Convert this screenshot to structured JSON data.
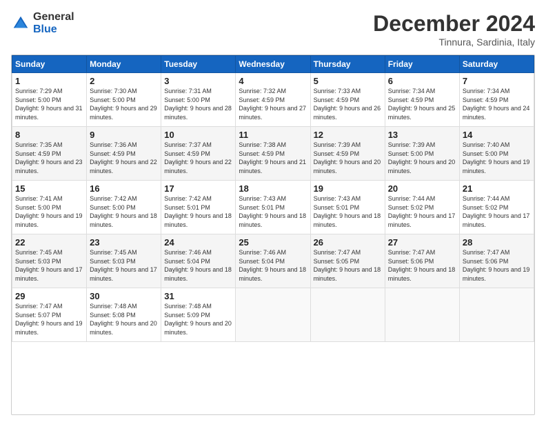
{
  "logo": {
    "general": "General",
    "blue": "Blue"
  },
  "title": "December 2024",
  "location": "Tinnura, Sardinia, Italy",
  "days_of_week": [
    "Sunday",
    "Monday",
    "Tuesday",
    "Wednesday",
    "Thursday",
    "Friday",
    "Saturday"
  ],
  "weeks": [
    [
      {
        "day": "1",
        "sunrise": "Sunrise: 7:29 AM",
        "sunset": "Sunset: 5:00 PM",
        "daylight": "Daylight: 9 hours and 31 minutes."
      },
      {
        "day": "2",
        "sunrise": "Sunrise: 7:30 AM",
        "sunset": "Sunset: 5:00 PM",
        "daylight": "Daylight: 9 hours and 29 minutes."
      },
      {
        "day": "3",
        "sunrise": "Sunrise: 7:31 AM",
        "sunset": "Sunset: 5:00 PM",
        "daylight": "Daylight: 9 hours and 28 minutes."
      },
      {
        "day": "4",
        "sunrise": "Sunrise: 7:32 AM",
        "sunset": "Sunset: 4:59 PM",
        "daylight": "Daylight: 9 hours and 27 minutes."
      },
      {
        "day": "5",
        "sunrise": "Sunrise: 7:33 AM",
        "sunset": "Sunset: 4:59 PM",
        "daylight": "Daylight: 9 hours and 26 minutes."
      },
      {
        "day": "6",
        "sunrise": "Sunrise: 7:34 AM",
        "sunset": "Sunset: 4:59 PM",
        "daylight": "Daylight: 9 hours and 25 minutes."
      },
      {
        "day": "7",
        "sunrise": "Sunrise: 7:34 AM",
        "sunset": "Sunset: 4:59 PM",
        "daylight": "Daylight: 9 hours and 24 minutes."
      }
    ],
    [
      {
        "day": "8",
        "sunrise": "Sunrise: 7:35 AM",
        "sunset": "Sunset: 4:59 PM",
        "daylight": "Daylight: 9 hours and 23 minutes."
      },
      {
        "day": "9",
        "sunrise": "Sunrise: 7:36 AM",
        "sunset": "Sunset: 4:59 PM",
        "daylight": "Daylight: 9 hours and 22 minutes."
      },
      {
        "day": "10",
        "sunrise": "Sunrise: 7:37 AM",
        "sunset": "Sunset: 4:59 PM",
        "daylight": "Daylight: 9 hours and 22 minutes."
      },
      {
        "day": "11",
        "sunrise": "Sunrise: 7:38 AM",
        "sunset": "Sunset: 4:59 PM",
        "daylight": "Daylight: 9 hours and 21 minutes."
      },
      {
        "day": "12",
        "sunrise": "Sunrise: 7:39 AM",
        "sunset": "Sunset: 4:59 PM",
        "daylight": "Daylight: 9 hours and 20 minutes."
      },
      {
        "day": "13",
        "sunrise": "Sunrise: 7:39 AM",
        "sunset": "Sunset: 5:00 PM",
        "daylight": "Daylight: 9 hours and 20 minutes."
      },
      {
        "day": "14",
        "sunrise": "Sunrise: 7:40 AM",
        "sunset": "Sunset: 5:00 PM",
        "daylight": "Daylight: 9 hours and 19 minutes."
      }
    ],
    [
      {
        "day": "15",
        "sunrise": "Sunrise: 7:41 AM",
        "sunset": "Sunset: 5:00 PM",
        "daylight": "Daylight: 9 hours and 19 minutes."
      },
      {
        "day": "16",
        "sunrise": "Sunrise: 7:42 AM",
        "sunset": "Sunset: 5:00 PM",
        "daylight": "Daylight: 9 hours and 18 minutes."
      },
      {
        "day": "17",
        "sunrise": "Sunrise: 7:42 AM",
        "sunset": "Sunset: 5:01 PM",
        "daylight": "Daylight: 9 hours and 18 minutes."
      },
      {
        "day": "18",
        "sunrise": "Sunrise: 7:43 AM",
        "sunset": "Sunset: 5:01 PM",
        "daylight": "Daylight: 9 hours and 18 minutes."
      },
      {
        "day": "19",
        "sunrise": "Sunrise: 7:43 AM",
        "sunset": "Sunset: 5:01 PM",
        "daylight": "Daylight: 9 hours and 18 minutes."
      },
      {
        "day": "20",
        "sunrise": "Sunrise: 7:44 AM",
        "sunset": "Sunset: 5:02 PM",
        "daylight": "Daylight: 9 hours and 17 minutes."
      },
      {
        "day": "21",
        "sunrise": "Sunrise: 7:44 AM",
        "sunset": "Sunset: 5:02 PM",
        "daylight": "Daylight: 9 hours and 17 minutes."
      }
    ],
    [
      {
        "day": "22",
        "sunrise": "Sunrise: 7:45 AM",
        "sunset": "Sunset: 5:03 PM",
        "daylight": "Daylight: 9 hours and 17 minutes."
      },
      {
        "day": "23",
        "sunrise": "Sunrise: 7:45 AM",
        "sunset": "Sunset: 5:03 PM",
        "daylight": "Daylight: 9 hours and 17 minutes."
      },
      {
        "day": "24",
        "sunrise": "Sunrise: 7:46 AM",
        "sunset": "Sunset: 5:04 PM",
        "daylight": "Daylight: 9 hours and 18 minutes."
      },
      {
        "day": "25",
        "sunrise": "Sunrise: 7:46 AM",
        "sunset": "Sunset: 5:04 PM",
        "daylight": "Daylight: 9 hours and 18 minutes."
      },
      {
        "day": "26",
        "sunrise": "Sunrise: 7:47 AM",
        "sunset": "Sunset: 5:05 PM",
        "daylight": "Daylight: 9 hours and 18 minutes."
      },
      {
        "day": "27",
        "sunrise": "Sunrise: 7:47 AM",
        "sunset": "Sunset: 5:06 PM",
        "daylight": "Daylight: 9 hours and 18 minutes."
      },
      {
        "day": "28",
        "sunrise": "Sunrise: 7:47 AM",
        "sunset": "Sunset: 5:06 PM",
        "daylight": "Daylight: 9 hours and 19 minutes."
      }
    ],
    [
      {
        "day": "29",
        "sunrise": "Sunrise: 7:47 AM",
        "sunset": "Sunset: 5:07 PM",
        "daylight": "Daylight: 9 hours and 19 minutes."
      },
      {
        "day": "30",
        "sunrise": "Sunrise: 7:48 AM",
        "sunset": "Sunset: 5:08 PM",
        "daylight": "Daylight: 9 hours and 20 minutes."
      },
      {
        "day": "31",
        "sunrise": "Sunrise: 7:48 AM",
        "sunset": "Sunset: 5:09 PM",
        "daylight": "Daylight: 9 hours and 20 minutes."
      },
      null,
      null,
      null,
      null
    ]
  ]
}
